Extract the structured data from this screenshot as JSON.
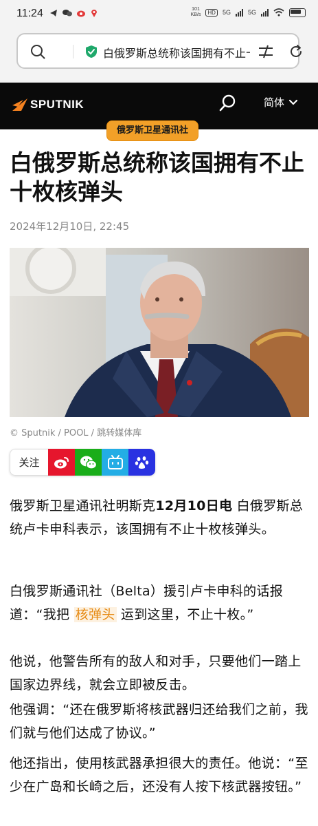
{
  "status_bar": {
    "time": "11:24",
    "speed_top": "101",
    "speed_bottom": "KB/s",
    "hd": "HD",
    "net1": "5G",
    "net2": "5G"
  },
  "browser": {
    "url_text": "白俄罗斯总统称该国拥有不止十枚核弹头"
  },
  "site": {
    "logo": "SPUTNIK",
    "lang": "简体",
    "brand_color": "#f58220"
  },
  "article": {
    "agency": "俄罗斯卫星通讯社",
    "headline": "白俄罗斯总统称该国拥有不止十枚核弹头",
    "date": "2024年12月10日, 22:45",
    "caption": "© Sputnik / POOL / 跳转媒体库",
    "share_follow": "关注",
    "p1_a": "俄罗斯卫星通讯社明斯克",
    "p1_b": "12月10日电",
    "p1_c": " 白俄罗斯总统卢卡申科表示，该国拥有不止十枚核弹头。",
    "p2_a": "白俄罗斯通讯社（Belta）援引卢卡申科的话报道：“我把 ",
    "p2_link": "核弹头",
    "p2_b": " 运到这里，不止十枚。”",
    "p3": "他说，他警告所有的敌人和对手，只要他们一踏上国家边界线，就会立即被反击。",
    "p4": "他强调：“还在俄罗斯将核武器归还给我们之前，我们就与他们达成了协议。”",
    "p5": "他还指出，使用核武器承担很大的责任。他说：“至少在广岛和长崎之后，还没有人按下核武器按钮。”"
  }
}
